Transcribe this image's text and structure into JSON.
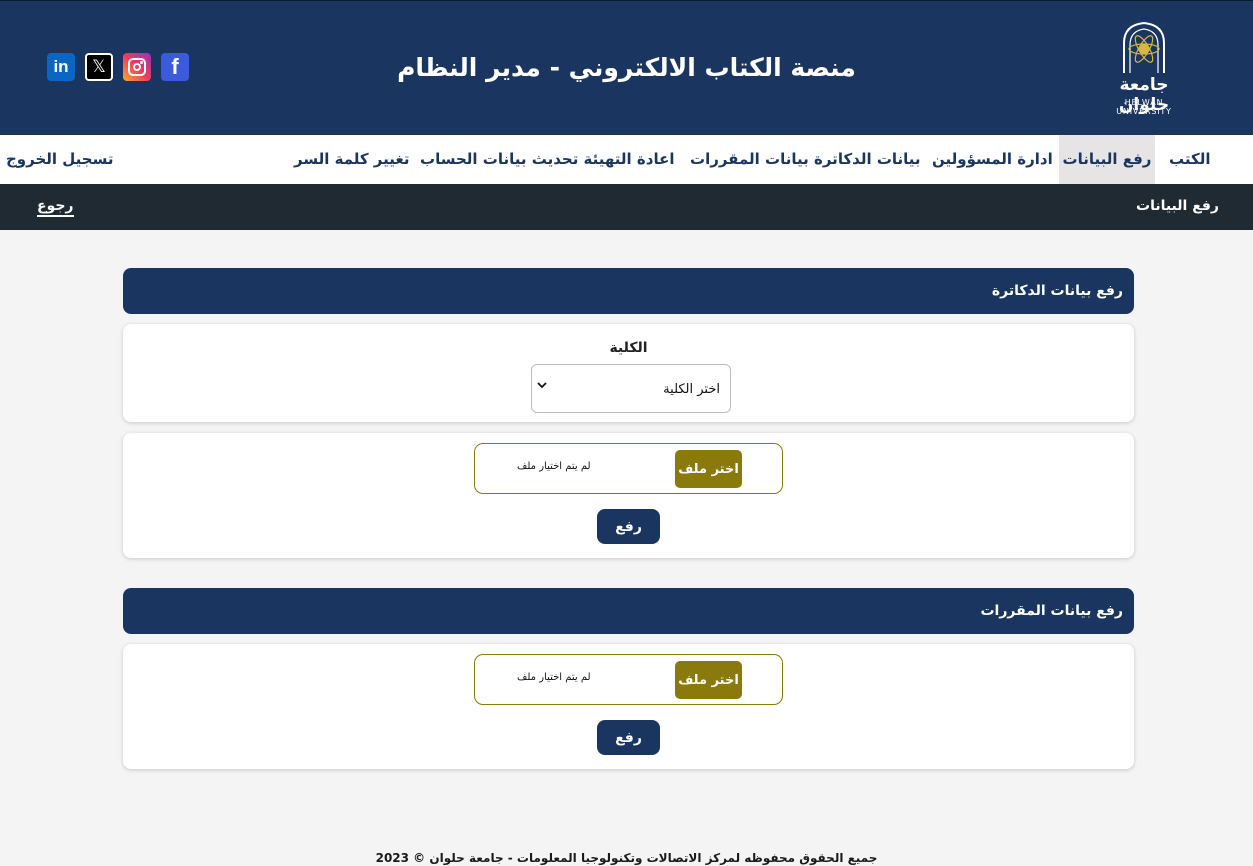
{
  "header": {
    "title": "منصة الكتاب الالكتروني - مدير النظام",
    "logo_ar": "جامعة حلوان",
    "logo_en": "HELWAN UNIVERSITY",
    "social": {
      "linkedin": "in",
      "x": "𝕏",
      "facebook": "f"
    }
  },
  "nav": {
    "items": [
      {
        "label": "الكتب"
      },
      {
        "label": "رفع البيانات"
      },
      {
        "label": "ادارة المسؤولين"
      },
      {
        "label": "بيانات الدكاترة"
      },
      {
        "label": "بيانات المقررات"
      },
      {
        "label": "اعادة التهيئة"
      },
      {
        "label": "تحديث بيانات الحساب"
      },
      {
        "label": "تغيير كلمة السر"
      }
    ],
    "logout": "تسجيل الخروج",
    "active_index": 1
  },
  "subbar": {
    "title": "رفع البيانات",
    "back": "رجوع"
  },
  "sections": [
    {
      "title": "رفع بيانات الدكاترة",
      "field_label": "الكلية",
      "select_value": "اختر الكلية",
      "file_button": "اختر ملف",
      "file_status": "لم يتم اختيار ملف",
      "upload_button": "رفع"
    },
    {
      "title": "رفع بيانات المقررات",
      "file_button": "اختر ملف",
      "file_status": "لم يتم اختيار ملف",
      "upload_button": "رفع"
    }
  ],
  "footer": {
    "text": "جميع الحقوق محفوظه لمركز الاتصالات وتكنولوجيا المعلومات - جامعة حلوان © 2023"
  },
  "colors": {
    "primary": "#1a355f",
    "accent": "#8a7a0c",
    "subbar": "#1f2a33",
    "background": "#f4f4f5",
    "nav_active": "#e6e4e4"
  }
}
